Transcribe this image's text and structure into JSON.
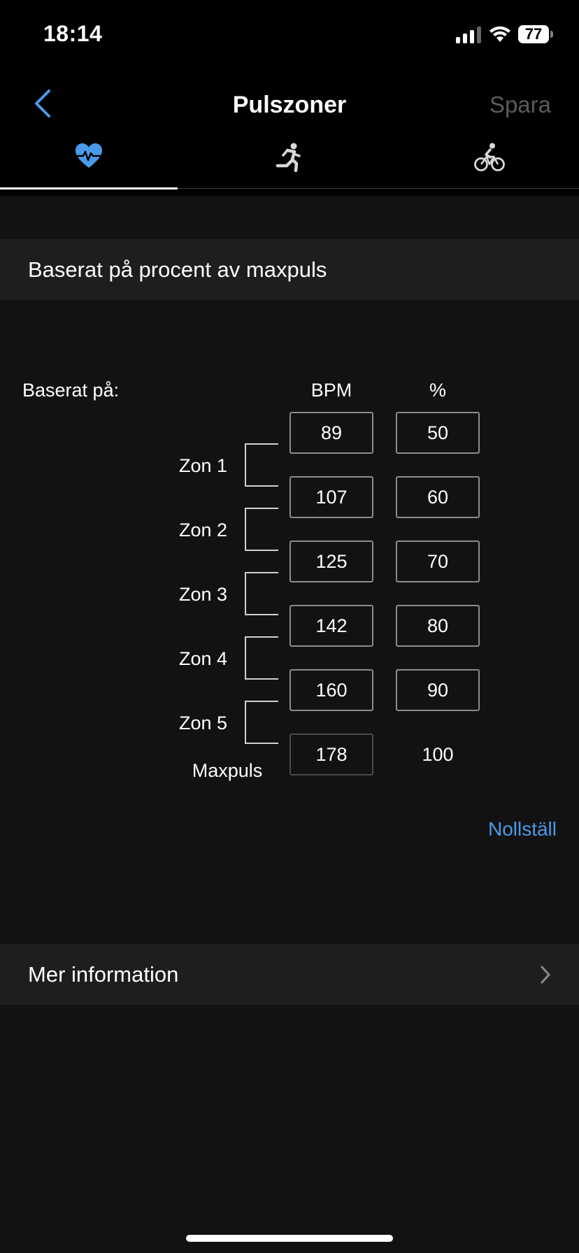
{
  "status_bar": {
    "time": "18:14",
    "battery": "77"
  },
  "nav": {
    "title": "Pulszoner",
    "save_label": "Spara"
  },
  "tabs": [
    {
      "icon": "heart-rate-icon",
      "active": true
    },
    {
      "icon": "running-icon",
      "active": false
    },
    {
      "icon": "cycling-icon",
      "active": false
    }
  ],
  "section_title": "Baserat på procent av maxpuls",
  "grid": {
    "based_on_label": "Baserat på:",
    "bpm_header": "BPM",
    "percent_header": "%",
    "bpm_values": [
      "89",
      "107",
      "125",
      "142",
      "160",
      "178"
    ],
    "percent_values": [
      "50",
      "60",
      "70",
      "80",
      "90",
      "100"
    ],
    "zones": [
      "Zon 1",
      "Zon 2",
      "Zon 3",
      "Zon 4",
      "Zon 5"
    ],
    "max_label": "Maxpuls"
  },
  "reset_label": "Nollställ",
  "more_info_label": "Mer information",
  "colors": {
    "accent": "#4a9ae8",
    "background": "#121212",
    "section": "#1e1e1e"
  }
}
